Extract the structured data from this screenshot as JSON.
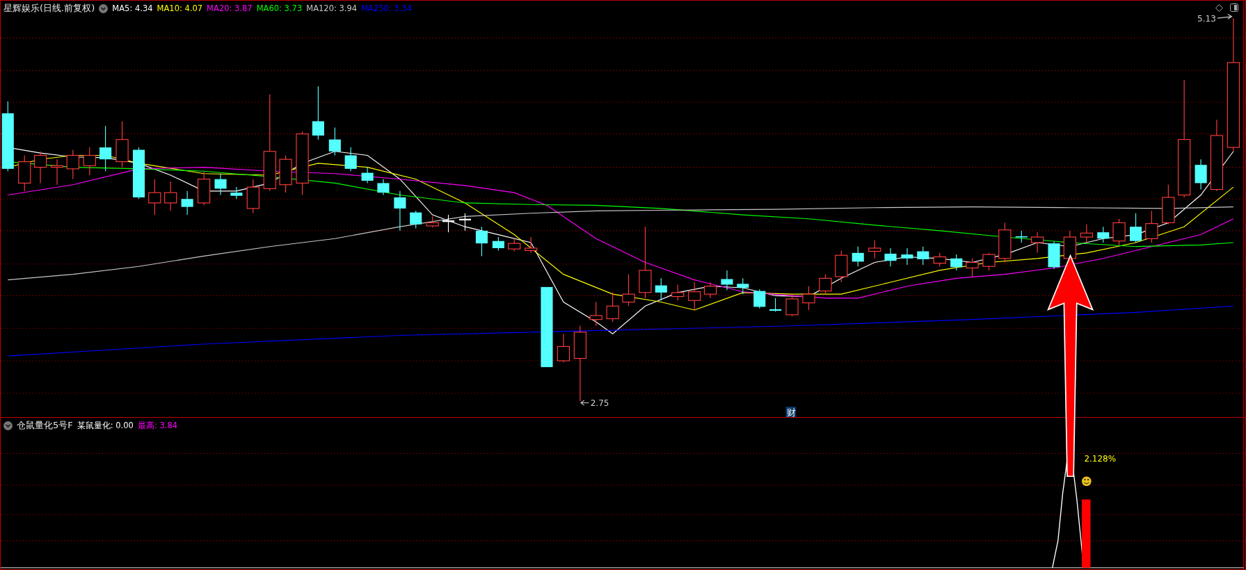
{
  "main_panel": {
    "title": "星辉娱乐(日线.前复权)",
    "indicators": [
      {
        "label": "MA5: 4.34",
        "color": "#ffffff"
      },
      {
        "label": "MA10: 4.07",
        "color": "#ffff00"
      },
      {
        "label": "MA20: 3.87",
        "color": "#ff00ff"
      },
      {
        "label": "MA60: 3.73",
        "color": "#00ff00"
      },
      {
        "label": "MA120: 3.94",
        "color": "#c8c8c8"
      },
      {
        "label": "MA250: 3.34",
        "color": "#0000ff"
      }
    ],
    "high_label": "5.13",
    "low_label": "2.75",
    "badge": "财"
  },
  "sub_panel": {
    "title": "仓鼠量化5号F",
    "indicators": [
      {
        "label": "某鼠量化: 0.00",
        "color": "#ffffff"
      },
      {
        "label": "最高: 3.84",
        "color": "#ff00ff"
      }
    ],
    "signal_label": "2.128%"
  }
}
